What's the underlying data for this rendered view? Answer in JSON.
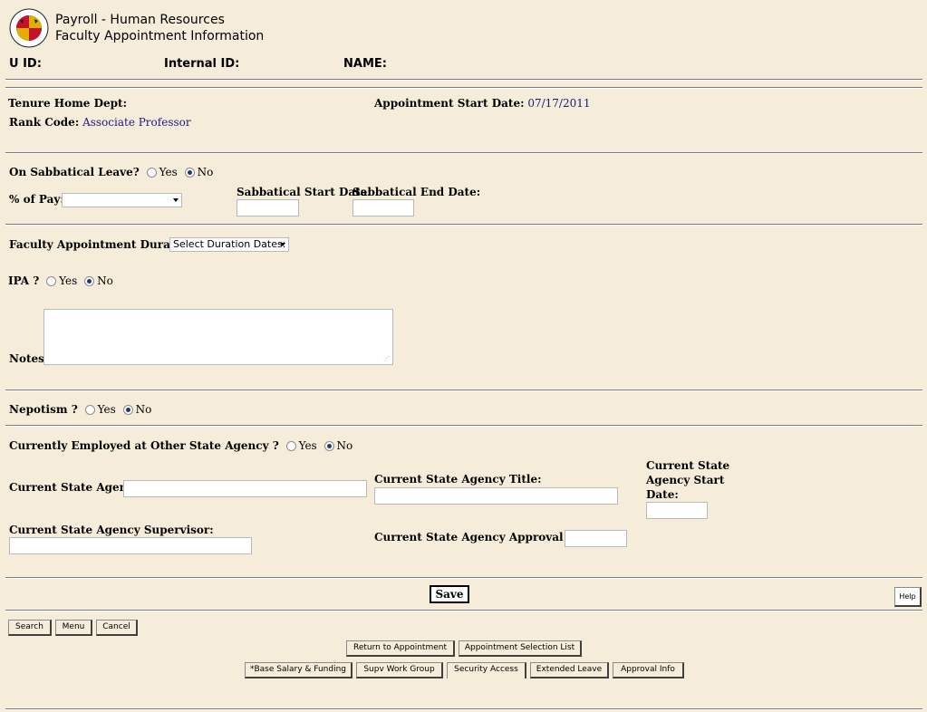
{
  "header": {
    "logo_text": "UNIVERSITY OF MARYLAND",
    "title_line1": "Payroll - Human Resources",
    "title_line2": "Faculty Appointment Information"
  },
  "ids": {
    "uid_label": "U ID:",
    "internal_id_label": "Internal ID:",
    "name_label": "NAME:"
  },
  "appointment": {
    "tenure_home_dept_label": "Tenure Home Dept:",
    "rank_code_label": "Rank Code:",
    "rank_code_value": "Associate Professor",
    "start_date_label": "Appointment Start Date:",
    "start_date_value": "07/17/2011"
  },
  "sabbatical": {
    "question": "On Sabbatical Leave?",
    "yes_label": "Yes",
    "no_label": "No",
    "selected": "No",
    "pct_pay_label": "% of Pay:",
    "pct_pay_value": "",
    "start_date_label": "Sabbatical Start Date:",
    "end_date_label": "Sabbatical End Date:"
  },
  "duration": {
    "label": "Faculty Appointment Duration:",
    "select_value": "Select Duration Dates:"
  },
  "ipa": {
    "label": "IPA ?",
    "yes_label": "Yes",
    "no_label": "No",
    "selected": "No"
  },
  "notes": {
    "label": "Notes:",
    "value": ""
  },
  "nepotism": {
    "label": "Nepotism ?",
    "yes_label": "Yes",
    "no_label": "No",
    "selected": "No"
  },
  "other_state": {
    "question": "Currently Employed at Other State Agency ?",
    "yes_label": "Yes",
    "no_label": "No",
    "selected": "No",
    "agency_label": "Current State Agency:",
    "title_label": "Current State Agency Title:",
    "start_date_label": [
      "Current State",
      "Agency Start",
      "Date:"
    ],
    "supervisor_label": "Current State Agency Supervisor:",
    "approval_date_label": "Current State Agency Approval Date:"
  },
  "actions": {
    "save": "Save",
    "help": "Help"
  },
  "nav_buttons": {
    "search": "Search",
    "menu": "Menu",
    "cancel": "Cancel",
    "return_to_appointment": "Return to Appointment",
    "appointment_selection_list": "Appointment Selection List",
    "base_salary": "*Base Salary & Funding",
    "supv_work_group": "Supv Work Group",
    "security_access": "Security Access",
    "extended_leave": "Extended Leave",
    "approval_info": "Approval Info"
  },
  "colors": {
    "background": "#f5ecd9",
    "value_text": "#1a1a80"
  }
}
